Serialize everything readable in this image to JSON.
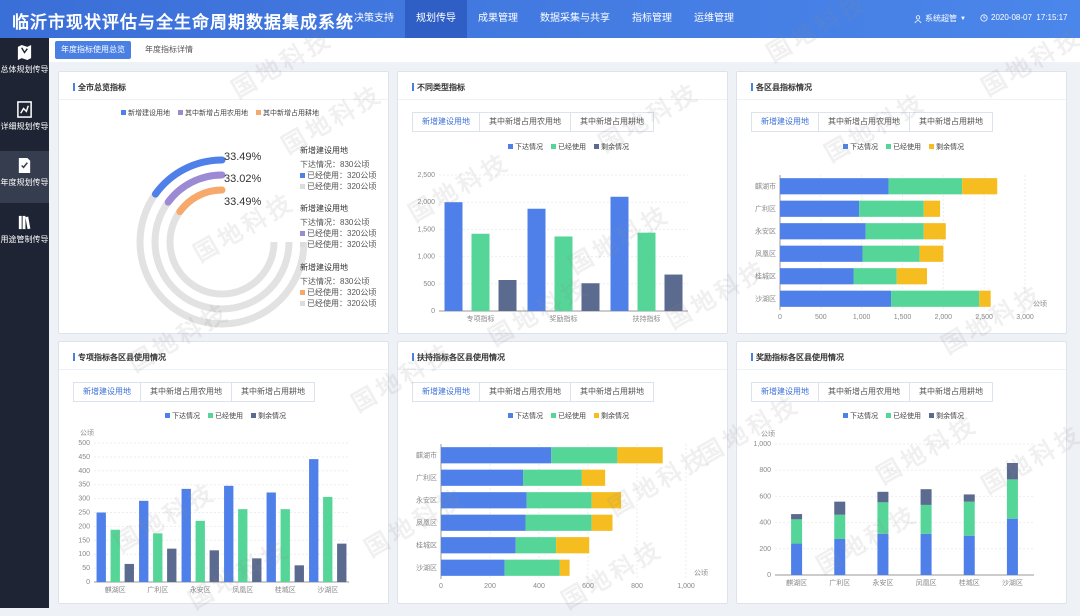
{
  "header": {
    "title": "临沂市现状评估与全生命周期数据集成系统",
    "nav": [
      "决策支持",
      "规划传导",
      "成果管理",
      "数据采集与共享",
      "指标管理",
      "运维管理"
    ],
    "active_nav": 1,
    "user": "系统超管",
    "datetime": "2020-08-07  17:15:17"
  },
  "sidebar": {
    "items": [
      {
        "label": "总体规划传导",
        "icon": "map-icon"
      },
      {
        "label": "详细规划传导",
        "icon": "document-chart-icon"
      },
      {
        "label": "年度规划传导",
        "icon": "checklist-icon"
      },
      {
        "label": "用途管制传导",
        "icon": "book-icon"
      }
    ],
    "active": 2
  },
  "tabs": [
    {
      "label": "年度指标使用总览",
      "active": true
    },
    {
      "label": "年度指标详情",
      "active": false
    }
  ],
  "colors": {
    "blue": "#4f80ea",
    "green": "#55d698",
    "slate": "#5b6a8f",
    "gold": "#f5bd1f",
    "purple": "#9d8ad4",
    "orange": "#f6a96a"
  },
  "legend3": [
    "下达情况",
    "已经使用",
    "剩余情况"
  ],
  "subtabs": [
    "新增建设用地",
    "其中新增占用农用地",
    "其中新增占用耕地"
  ],
  "watermark": "国地科技",
  "panels": {
    "p1": {
      "title": "全市总览指标",
      "legend": [
        "新增建设用地",
        "其中新增占用农用地",
        "其中新增占用耕地"
      ],
      "percents": [
        "33.49%",
        "33.02%",
        "33.49%"
      ],
      "details": [
        {
          "heading": "新增建设用地",
          "issued": "下达情况：830公顷",
          "used1": "已经使用：320公顷",
          "used2": "已经使用：320公顷"
        },
        {
          "heading": "新增建设用地",
          "issued": "下达情况：830公顷",
          "used1": "已经使用：320公顷",
          "used2": "已经使用：320公顷"
        },
        {
          "heading": "新增建设用地",
          "issued": "下达情况：830公顷",
          "used1": "已经使用：320公顷",
          "used2": "已经使用：320公顷"
        }
      ]
    },
    "p2": {
      "title": "不同类型指标"
    },
    "p3": {
      "title": "各区县指标情况"
    },
    "p4": {
      "title": "专项指标各区县使用情况"
    },
    "p5": {
      "title": "扶持指标各区县使用情况"
    },
    "p6": {
      "title": "奖励指标各区县使用情况"
    }
  },
  "chart_data": [
    {
      "type": "pie",
      "title": "全市总览指标",
      "categories": [
        "新增建设用地",
        "其中新增占用农用地",
        "其中新增占用耕地"
      ],
      "values": [
        33.49,
        33.02,
        33.49
      ],
      "unit": "%"
    },
    {
      "type": "bar",
      "title": "不同类型指标",
      "categories": [
        "专项指标",
        "奖励指标",
        "扶持指标"
      ],
      "series": [
        {
          "name": "下达情况",
          "values": [
            2000,
            1880,
            2100
          ]
        },
        {
          "name": "已经使用",
          "values": [
            1420,
            1370,
            1440
          ]
        },
        {
          "name": "剩余情况",
          "values": [
            570,
            510,
            670
          ]
        }
      ],
      "ylim": [
        0,
        2500
      ],
      "yticks": [
        0,
        500,
        "1,000",
        "1,500",
        "2,000",
        "2,500"
      ]
    },
    {
      "type": "bar",
      "orientation": "horizontal",
      "stacked": true,
      "title": "各区县指标情况",
      "categories": [
        "沙湖区",
        "桂城区",
        "凤凰区",
        "永安区",
        "广利区",
        "麒湖市"
      ],
      "series": [
        {
          "name": "下达情况",
          "values": [
            1360,
            900,
            1010,
            1050,
            970,
            1330
          ]
        },
        {
          "name": "已经使用",
          "values": [
            1080,
            530,
            700,
            710,
            790,
            900
          ]
        },
        {
          "name": "剩余情况",
          "values": [
            140,
            370,
            290,
            270,
            200,
            430
          ]
        }
      ],
      "xlim": [
        0,
        3000
      ],
      "xticks": [
        "0",
        "500",
        "1,000",
        "1,500",
        "2,000",
        "2,500",
        "3,000"
      ],
      "unit": "公顷"
    },
    {
      "type": "bar",
      "title": "专项指标各区县使用情况",
      "categories": [
        "麒湖区",
        "广利区",
        "永安区",
        "凤凰区",
        "桂城区",
        "沙湖区"
      ],
      "series": [
        {
          "name": "下达情况",
          "values": [
            250,
            292,
            335,
            346,
            322,
            442
          ]
        },
        {
          "name": "已经使用",
          "values": [
            188,
            175,
            220,
            262,
            262,
            306
          ]
        },
        {
          "name": "剩余情况",
          "values": [
            65,
            120,
            114,
            85,
            60,
            138
          ]
        }
      ],
      "ylim": [
        0,
        500
      ],
      "ylabel": "公顷"
    },
    {
      "type": "bar",
      "orientation": "horizontal",
      "stacked": true,
      "title": "扶持指标各区县使用情况",
      "categories": [
        "沙湖区",
        "桂城区",
        "凤凰区",
        "永安区",
        "广利区",
        "麒湖市"
      ],
      "series": [
        {
          "name": "下达情况",
          "values": [
            260,
            305,
            345,
            350,
            335,
            450
          ]
        },
        {
          "name": "已经使用",
          "values": [
            225,
            165,
            270,
            265,
            240,
            270
          ]
        },
        {
          "name": "剩余情况",
          "values": [
            40,
            135,
            85,
            120,
            95,
            185
          ]
        }
      ],
      "xlim": [
        0,
        1000
      ],
      "xticks": [
        "0",
        "200",
        "400",
        "600",
        "800",
        "1,000"
      ],
      "unit": "公顷"
    },
    {
      "type": "bar",
      "stacked": true,
      "title": "奖励指标各区县使用情况",
      "categories": [
        "麒湖区",
        "广利区",
        "永安区",
        "凤凰区",
        "桂城区",
        "沙湖区"
      ],
      "series": [
        {
          "name": "下达情况",
          "values": [
            240,
            275,
            315,
            315,
            300,
            430
          ]
        },
        {
          "name": "已经使用",
          "values": [
            185,
            185,
            240,
            220,
            260,
            300
          ]
        },
        {
          "name": "剩余情况",
          "values": [
            40,
            100,
            80,
            120,
            55,
            125
          ]
        }
      ],
      "ylim": [
        0,
        1000
      ],
      "ylabel": "公顷"
    }
  ]
}
